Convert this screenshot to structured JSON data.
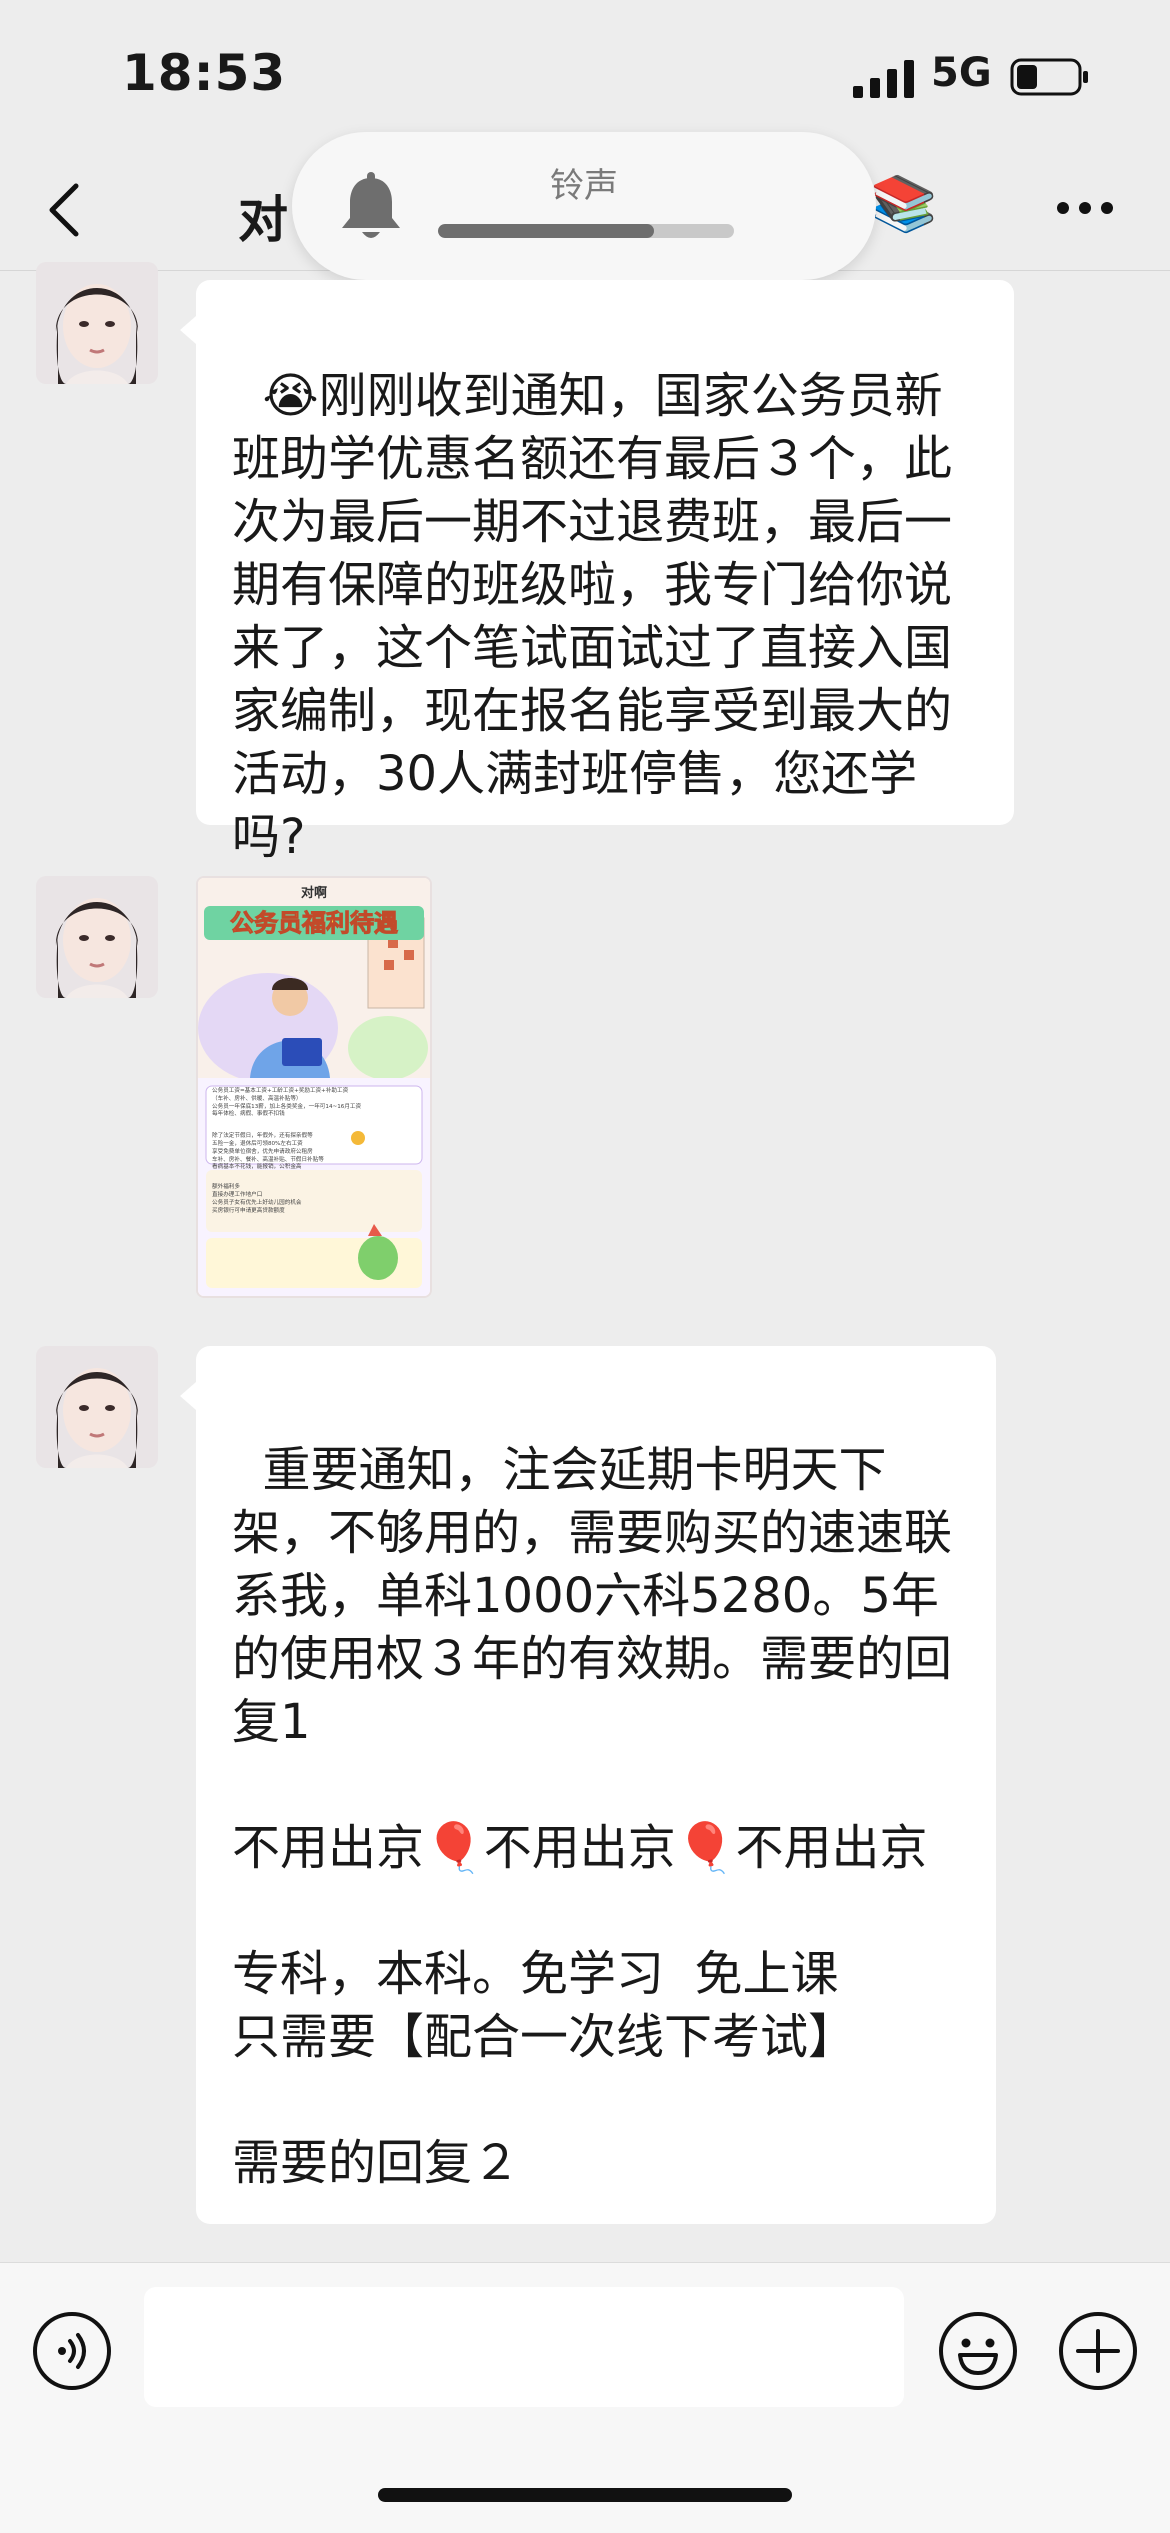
{
  "status_bar": {
    "time": "18:53",
    "network": "5G",
    "battery_level": 0.35
  },
  "header": {
    "title_visible": "对",
    "books_icon": "📚"
  },
  "ringtone_overlay": {
    "label": "铃声",
    "volume": 0.73
  },
  "messages": [
    {
      "type": "text",
      "text": "😭刚刚收到通知，国家公务员新班助学优惠名额还有最后３个，此次为最后一期不过退费班，最后一期有保障的班级啦，我专门给你说来了，这个笔试面试过了直接入国家编制，现在报名能享受到最大的活动，30人满封班停售，您还学吗?"
    },
    {
      "type": "image",
      "poster": {
        "brand": "对啊",
        "title": "公务员福利待遇",
        "items": [
          "公务员工资=基本工资+工龄工资+奖励工资+补助工资",
          "（车补、房补、供暖、高温补贴等）",
          "公务员一年保底13薪，加上各类奖金，一年可14~16月工资",
          "每年体检、病假、事假不扣钱",
          "除了法定节假日，年假外，还有探亲假等",
          "五险一金，退休后可领80%左右工资",
          "享受免费单位宿舍，优先申请政府公租房",
          "车补、房补、餐补、高温补贴、节假日补贴等",
          "看病基本不花钱，能报销，公积金高",
          "额外福利多",
          "直接办理工作地户口",
          "公务员子女有优先上好幼儿园的机会",
          "买房银行可申请更高贷款额度"
        ]
      }
    },
    {
      "type": "text",
      "text": "重要通知，注会延期卡明天下架，不够用的，需要购买的速速联系我，单科1000六科5280。5年的使用权３年的有效期。需要的回复1\n\n不用出京🎈不用出京🎈不用出京\n\n专科，本科。免学习  免上课\n只需要【配合一次线下考试】\n\n需要的回复２"
    }
  ],
  "input": {
    "placeholder": ""
  }
}
